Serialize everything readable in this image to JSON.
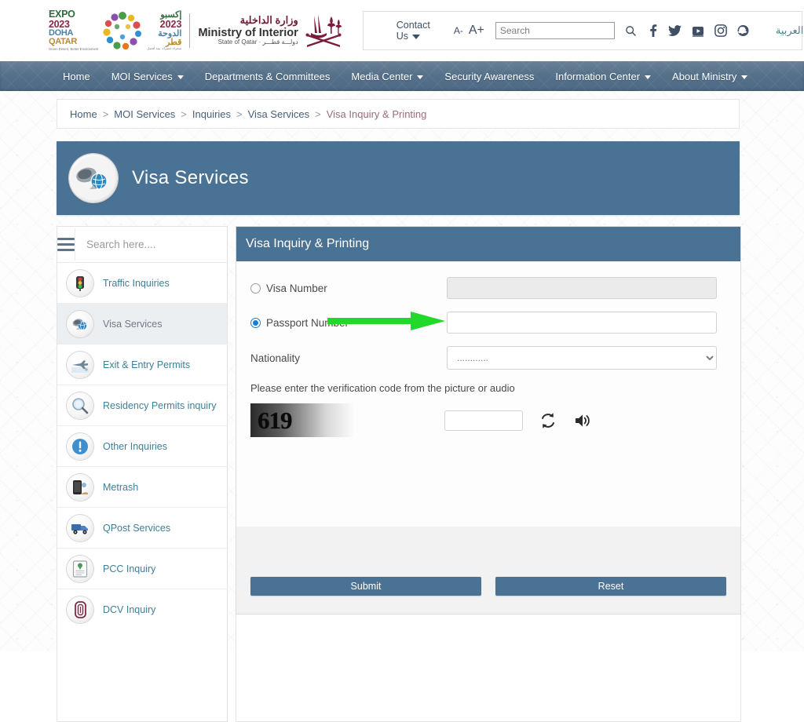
{
  "header": {
    "expo_logo": {
      "line1": "EXPO",
      "line2": "2023",
      "line3": "DOHA",
      "line4": "QATAR",
      "tagline": "Green Desert,\nBetter Environment",
      "ar_line1": "إكسبو",
      "ar_line2": "2023",
      "ar_line3": "الدوحة",
      "ar_line4": "قطر",
      "ar_tagline": "صحراء خضراء، بيئة أفضل"
    },
    "ministry": {
      "arabic": "وزارة الداخلية",
      "english": "Ministry of Interior",
      "subtitle": "State of Qatar · دولـــة قطـــر",
      "emblem_name": "qatar-emblem"
    },
    "contact_us": "Contact Us",
    "font_smaller": "A-",
    "font_larger": "A+",
    "search_placeholder": "Search",
    "search_value": "",
    "social": [
      {
        "name": "facebook-icon",
        "glyph": "f"
      },
      {
        "name": "twitter-icon",
        "glyph": "t"
      },
      {
        "name": "youtube-icon",
        "glyph": "y"
      },
      {
        "name": "instagram-icon",
        "glyph": "i"
      },
      {
        "name": "snapchat-icon",
        "glyph": "s"
      }
    ],
    "arabic_link": "العربية"
  },
  "nav": {
    "items": [
      {
        "label": "Home",
        "has_dropdown": false
      },
      {
        "label": "MOI Services",
        "has_dropdown": true
      },
      {
        "label": "Departments & Committees",
        "has_dropdown": false
      },
      {
        "label": "Media Center",
        "has_dropdown": true
      },
      {
        "label": "Security Awareness",
        "has_dropdown": false
      },
      {
        "label": "Information Center",
        "has_dropdown": true
      },
      {
        "label": "About Ministry",
        "has_dropdown": true
      }
    ]
  },
  "breadcrumb": {
    "separator": ">",
    "items": [
      {
        "label": "Home",
        "current": false
      },
      {
        "label": "MOI Services",
        "current": false
      },
      {
        "label": "Inquiries",
        "current": false
      },
      {
        "label": "Visa Services",
        "current": false
      },
      {
        "label": "Visa Inquiry & Printing",
        "current": true
      }
    ]
  },
  "banner": {
    "title": "Visa Services",
    "icon_name": "visa-globe-icon"
  },
  "sidebar": {
    "search_placeholder": "Search here....",
    "search_value": "",
    "menu_icon_name": "hamburger-menu-icon",
    "items": [
      {
        "label": "Traffic Inquiries",
        "icon": "traffic-light-icon",
        "active": false
      },
      {
        "label": "Visa Services",
        "icon": "visa-globe-icon",
        "active": true
      },
      {
        "label": "Exit & Entry Permits",
        "icon": "airplane-icon",
        "active": false
      },
      {
        "label": "Residency Permits inquiry",
        "icon": "magnifier-icon",
        "active": false
      },
      {
        "label": "Other Inquiries",
        "icon": "info-exclamation-icon",
        "active": false
      },
      {
        "label": "Metrash",
        "icon": "mobile-phone-icon",
        "active": false
      },
      {
        "label": "QPost Services",
        "icon": "delivery-truck-icon",
        "active": false
      },
      {
        "label": "PCC Inquiry",
        "icon": "certificate-icon",
        "active": false
      },
      {
        "label": "DCV Inquiry",
        "icon": "document-card-icon",
        "active": false
      }
    ]
  },
  "form": {
    "panel_title": "Visa Inquiry & Printing",
    "visa_number": {
      "label": "Visa Number",
      "selected": false,
      "value": "",
      "disabled": true
    },
    "passport_number": {
      "label": "Passport Number",
      "selected": true,
      "value": "",
      "disabled": false
    },
    "nationality": {
      "label": "Nationality",
      "selected_option": "............",
      "options": [
        "............"
      ]
    },
    "verification_note": "Please enter the verification code from the picture or audio",
    "captcha": {
      "code": "619",
      "input_value": "",
      "refresh_icon": "refresh-icon",
      "audio_icon": "speaker-icon"
    },
    "submit_label": "Submit",
    "reset_label": "Reset"
  },
  "annotation": {
    "arrow_color": "#22d92a",
    "arrow_points_to": "passport-number-input"
  },
  "colors": {
    "primary_blue": "#4a7294",
    "nav_blue": "#55708a",
    "link_teal": "#3f7f96",
    "breadcrumb_current": "#9c6c78",
    "maroon": "#6e1b34"
  }
}
